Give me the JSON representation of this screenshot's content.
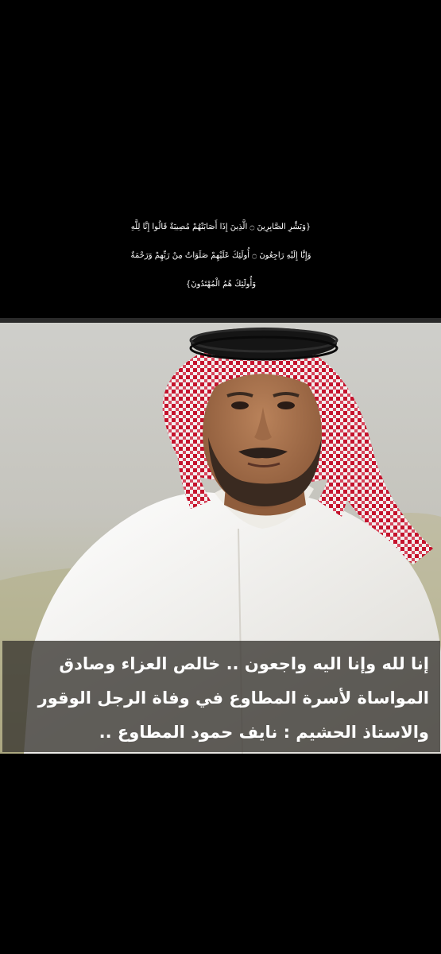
{
  "verse": {
    "line1": "{وَبَشِّرِ الصَّابِرِينَ ۝ الَّذِينَ إِذَا أَصَابَتْهُمْ مُصِيبَةٌ قَالُوا إِنَّا لِلَّهِ",
    "line2": "وَإِنَّا إِلَيْهِ رَاجِعُونَ ۝ أُولَئِكَ عَلَيْهِمْ صَلَوَاتٌ مِنْ رَبِّهِمْ وَرَحْمَةٌ",
    "line3": "وَأُولَئِكَ هُمُ الْمُهْتَدُونَ}"
  },
  "caption": {
    "line1": "إنا لله وإنا اليه واجعون .. خالص العزاء وصادق",
    "line2": "المواساة لأسرة المطاوع في وفاة الرجل الوقور",
    "line3": "والاستاذ الحشيم : نايف حمود المطاوع .."
  },
  "colors": {
    "background": "#000000",
    "text": "#ffffff",
    "caption_bg": "#37342f",
    "thobe": "#f4f2ee",
    "shemagh_red": "#c4122c",
    "agal": "#151515"
  }
}
